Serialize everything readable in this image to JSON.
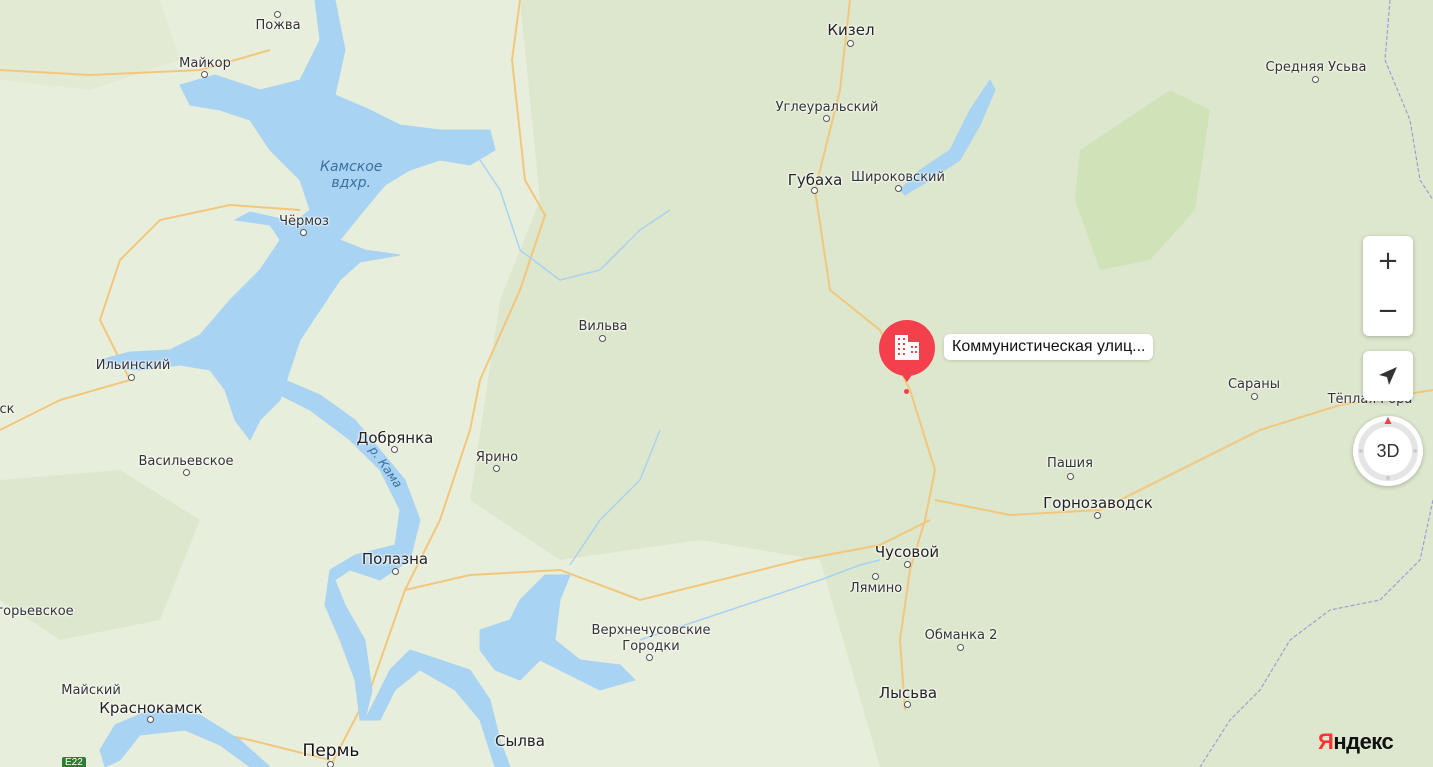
{
  "map": {
    "water_label": [
      "Камское",
      "вдхр."
    ],
    "river_label": "р. Кама",
    "places": [
      {
        "name": "Пожва",
        "size": "small"
      },
      {
        "name": "Майкор",
        "size": "small"
      },
      {
        "name": "Кизел",
        "size": "big"
      },
      {
        "name": "Углеуральский",
        "size": "small"
      },
      {
        "name": "Средняя Усьва",
        "size": "small"
      },
      {
        "name": "Губаха",
        "size": "big"
      },
      {
        "name": "Широковский",
        "size": "small"
      },
      {
        "name": "Чёрмоз",
        "size": "small"
      },
      {
        "name": "Вильва",
        "size": "small"
      },
      {
        "name": "Ильинский",
        "size": "small"
      },
      {
        "name": "Сараны",
        "size": "small"
      },
      {
        "name": "Тёплая Гора",
        "size": "small"
      },
      {
        "name": "ск",
        "size": "small"
      },
      {
        "name": "Добрянка",
        "size": "big"
      },
      {
        "name": "Васильевское",
        "size": "small"
      },
      {
        "name": "Ярино",
        "size": "small"
      },
      {
        "name": "Пашия",
        "size": "small"
      },
      {
        "name": "Горнозаводск",
        "size": "big"
      },
      {
        "name": "Полазна",
        "size": "big"
      },
      {
        "name": "Чусовой",
        "size": "big"
      },
      {
        "name": "Лямино",
        "size": "small"
      },
      {
        "name": "горьевское",
        "size": "small"
      },
      {
        "name": "Верхнечусовские",
        "size": "small"
      },
      {
        "name": "Городки",
        "size": "small"
      },
      {
        "name": "Обманка 2",
        "size": "small"
      },
      {
        "name": "Майский",
        "size": "small"
      },
      {
        "name": "Лысьва",
        "size": "big"
      },
      {
        "name": "Краснокамск",
        "size": "big"
      },
      {
        "name": "Пермь",
        "size": "big2"
      },
      {
        "name": "Сылва",
        "size": "big"
      }
    ],
    "road_badge": "E22"
  },
  "pin": {
    "label": "Коммунистическая улиц...",
    "icon": "building-icon",
    "color": "#f43f4c"
  },
  "controls": {
    "zoom_in": "+",
    "zoom_out": "−",
    "locate_icon": "navigation-arrow-icon",
    "view_3d": "3D"
  },
  "brand": {
    "logo_first": "Я",
    "logo_rest": "ндекс"
  },
  "colors": {
    "land": "#e6ecd9",
    "forest": "#d9e6c8",
    "water": "#a9d3f2",
    "road": "#f5c97a",
    "boundary": "#8a8fc7",
    "pin": "#f43f4c",
    "accent": "#2e7d32"
  }
}
